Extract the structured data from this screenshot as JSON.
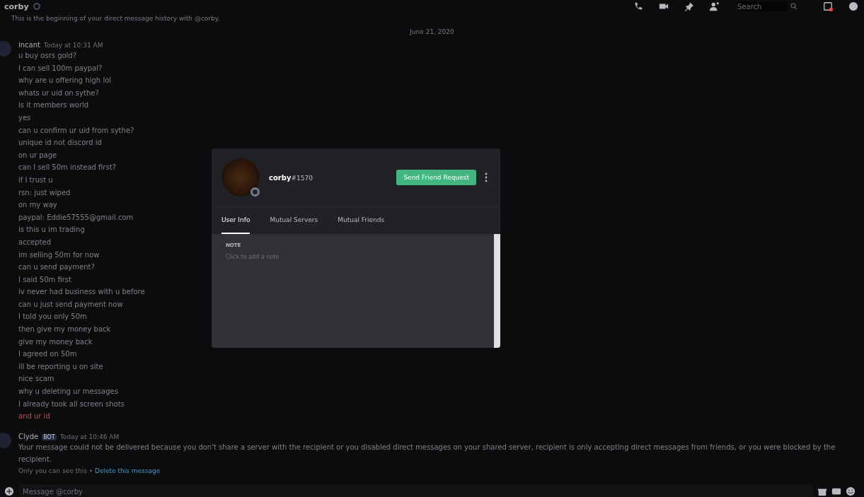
{
  "header": {
    "title": "corby",
    "search": {
      "placeholder": "Search"
    }
  },
  "intro": "This is the beginning of your direct message history with @corby.",
  "date_divider": "June 21, 2020",
  "messages": [
    {
      "author": "incant",
      "timestamp": "Today at 10:31 AM",
      "lines": [
        {
          "text": "u buy osrs gold?",
          "failed": false
        },
        {
          "text": "I can sell 100m paypal?",
          "failed": false
        },
        {
          "text": "why are u offering high lol",
          "failed": false
        },
        {
          "text": "whats ur uid on sythe?",
          "failed": false
        },
        {
          "text": "is it members world",
          "failed": false
        },
        {
          "text": "yes",
          "failed": false
        },
        {
          "text": "can u confirm ur uid from sythe?",
          "failed": false
        },
        {
          "text": "unique id not discord id",
          "failed": false
        },
        {
          "text": "on ur page",
          "failed": false
        },
        {
          "text": "can I sell 50m instead first?",
          "failed": false
        },
        {
          "text": "if I trust u",
          "failed": false
        },
        {
          "text": "rsn: just wiped",
          "failed": false
        },
        {
          "text": "on my way",
          "failed": false
        },
        {
          "text": "paypal: Eddie57555@gmail.com",
          "failed": false
        },
        {
          "text": "is this u im trading",
          "failed": false
        },
        {
          "text": "accepted",
          "failed": false
        },
        {
          "text": "im selling 50m for now",
          "failed": false
        },
        {
          "text": "can u send payment?",
          "failed": false
        },
        {
          "text": "I said 50m first",
          "failed": false
        },
        {
          "text": "iv never had business with u before",
          "failed": false
        },
        {
          "text": "can u just send payment now",
          "failed": false
        },
        {
          "text": "I told you only 50m",
          "failed": false
        },
        {
          "text": "then give my money back",
          "failed": false
        },
        {
          "text": "give my money back",
          "failed": false
        },
        {
          "text": "I agreed on 50m",
          "failed": false
        },
        {
          "text": "ill be reporting u on site",
          "failed": false
        },
        {
          "text": "nice scam",
          "failed": false
        },
        {
          "text": "why u deleting ur messages",
          "failed": false
        },
        {
          "text": "I already took all screen shots",
          "failed": false
        },
        {
          "text": "and ur id",
          "failed": true
        }
      ]
    },
    {
      "author": "Clyde",
      "timestamp": "Today at 10:46 AM",
      "bot_tag": "BOT",
      "lines": [
        {
          "text": "Your message could not be delivered because you don't share a server with the recipient or you disabled direct messages on your shared server, recipient is only accepting direct messages from friends, or you were blocked by the recipient.",
          "failed": false
        }
      ],
      "note": "Only you can see this •",
      "note_link": "Delete this message"
    }
  ],
  "composer": {
    "placeholder": "Message @corby"
  },
  "modal": {
    "username": "corby",
    "discriminator": "#1570",
    "button": "Send Friend Request",
    "tabs": [
      {
        "label": "User Info",
        "selected": true
      },
      {
        "label": "Mutual Servers",
        "selected": false
      },
      {
        "label": "Mutual Friends",
        "selected": false
      }
    ],
    "note_heading": "NOTE",
    "note": {
      "placeholder": "Click to add a note"
    }
  }
}
